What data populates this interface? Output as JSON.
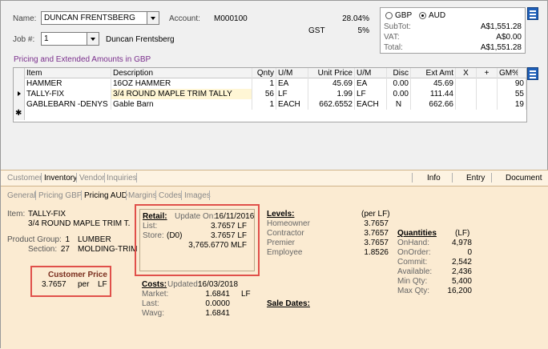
{
  "header": {
    "name_label": "Name:",
    "name_value": "DUNCAN FRENTSBERG",
    "account_label": "Account:",
    "account_value": "M000100",
    "job_label": "Job #:",
    "job_value": "1",
    "job_name": "Duncan Frentsberg",
    "gst_label": "GST",
    "rate_top": "28.04%",
    "rate_gst": "5%"
  },
  "totals": {
    "currency_gbp": "GBP",
    "currency_aud": "AUD",
    "subtot_label": "SubTot:",
    "subtot_value": "A$1,551.28",
    "vat_label": "VAT:",
    "vat_value": "A$0.00",
    "total_label": "Total:",
    "total_value": "A$1,551.28"
  },
  "section_title": "Pricing and Extended Amounts in GBP",
  "grid": {
    "headers": {
      "item": "Item",
      "description": "Description",
      "qnty": "Qnty",
      "um": "U/M",
      "unit_price": "Unit Price",
      "um2": "U/M",
      "disc": "Disc",
      "ext_amt": "Ext Amt",
      "x": "X",
      "plus": "+",
      "gm": "GM%"
    },
    "rows": [
      {
        "item": "HAMMER",
        "description": "16OZ HAMMER",
        "qnty": "1",
        "um": "EA",
        "unit_price": "45.69",
        "um2": "EA",
        "disc": "0.00",
        "ext_amt": "45.69",
        "gm": "90"
      },
      {
        "item": "TALLY-FIX",
        "description": "3/4 ROUND MAPLE TRIM TALLY",
        "qnty": "56",
        "um": "LF",
        "unit_price": "1.99",
        "um2": "LF",
        "disc": "0.00",
        "ext_amt": "111.44",
        "gm": "55"
      },
      {
        "item": "GABLEBARN -DENYS",
        "description": "Gable Barn",
        "qnty": "1",
        "um": "EACH",
        "unit_price": "662.6552",
        "um2": "EACH",
        "disc": "N",
        "ext_amt": "662.66",
        "gm": "19"
      }
    ]
  },
  "tabs": {
    "customer": "Customer",
    "inventory": "Inventory",
    "vendor": "Vendor",
    "inquiries": "Inquiries",
    "info": "Info",
    "entry": "Entry",
    "document": "Document"
  },
  "subtabs": {
    "general": "General",
    "pricing_gbp": "Pricing GBP",
    "pricing_aud": "Pricing AUD",
    "margins": "Margins",
    "codes": "Codes",
    "images": "Images"
  },
  "inventory": {
    "item_label": "Item:",
    "item_code": "TALLY-FIX",
    "item_desc": "3/4 ROUND MAPLE TRIM T.",
    "product_group_label": "Product Group:",
    "product_group_num": "1",
    "product_group_name": "LUMBER",
    "section_label": "Section:",
    "section_num": "27",
    "section_name": "MOLDING-TRIM",
    "customer_price_title": "Customer Price",
    "customer_price_value": "3.7657",
    "customer_price_per": "per",
    "customer_price_unit": "LF",
    "retail_title": "Retail:",
    "update_on_label": "Update On:",
    "update_on_value": "16/11/2016",
    "list_label": "List:",
    "list_value": "3.7657 LF",
    "store_label": "Store:",
    "store_code": "(D0)",
    "store_value": "3.7657 LF",
    "store_mlf": "3,765.6770 MLF",
    "costs_title": "Costs:",
    "costs_updated_label": "Updated:",
    "costs_updated_value": "16/03/2018",
    "market_label": "Market:",
    "market_value": "1.6841",
    "market_unit": "LF",
    "last_label": "Last:",
    "last_value": "0.0000",
    "wavg_label": "Wavg:",
    "wavg_value": "1.6841",
    "levels_title": "Levels:",
    "levels_per": "(per LF)",
    "levels": [
      {
        "name": "Homeowner",
        "value": "3.7657"
      },
      {
        "name": "Contractor",
        "value": "3.7657"
      },
      {
        "name": "Premier",
        "value": "3.7657"
      },
      {
        "name": "Employee",
        "value": "1.8526"
      }
    ],
    "sale_dates_title": "Sale Dates:",
    "quantities_title": "Quantities",
    "quantities_unit": "(LF)",
    "quantities": [
      {
        "name": "OnHand:",
        "value": "4,978"
      },
      {
        "name": "OnOrder:",
        "value": "0"
      },
      {
        "name": "Commit:",
        "value": "2,542"
      },
      {
        "name": "Available:",
        "value": "2,436"
      },
      {
        "name": "Min Qty:",
        "value": "5,400"
      },
      {
        "name": "Max Qty:",
        "value": "16,200"
      }
    ]
  }
}
